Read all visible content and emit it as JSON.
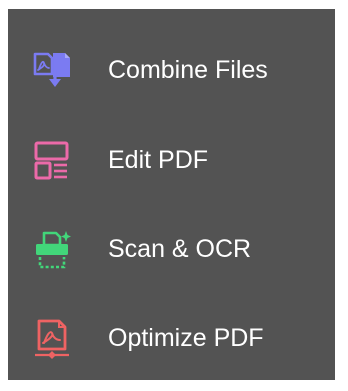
{
  "tools": [
    {
      "label": "Combine Files",
      "icon": "combine-files-icon",
      "color": "#7b7bf2"
    },
    {
      "label": "Edit PDF",
      "icon": "edit-pdf-icon",
      "color": "#ec6aa9"
    },
    {
      "label": "Scan & OCR",
      "icon": "scan-ocr-icon",
      "color": "#42d67a"
    },
    {
      "label": "Optimize PDF",
      "icon": "optimize-pdf-icon",
      "color": "#ef6363"
    }
  ]
}
